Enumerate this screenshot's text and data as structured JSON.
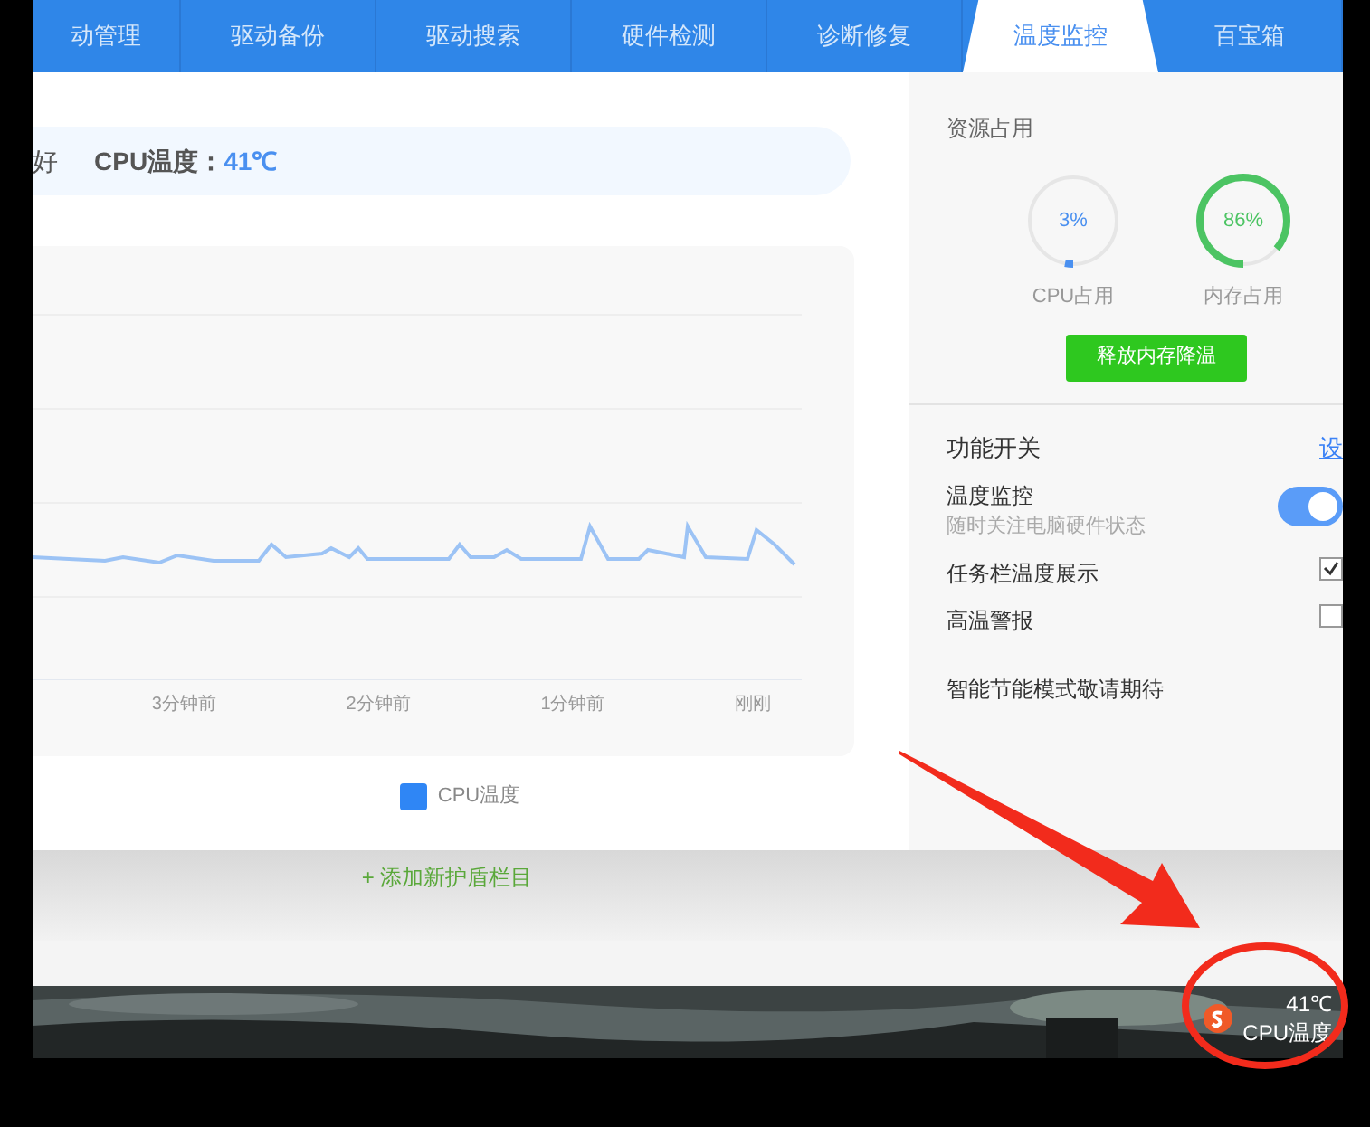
{
  "tabs": [
    {
      "label": "动管理",
      "selected": false
    },
    {
      "label": "驱动备份",
      "selected": false
    },
    {
      "label": "驱动搜索",
      "selected": false
    },
    {
      "label": "硬件检测",
      "selected": false
    },
    {
      "label": "诊断修复",
      "selected": false
    },
    {
      "label": "温度监控",
      "selected": true
    },
    {
      "label": "百宝箱",
      "selected": false
    }
  ],
  "status": {
    "state": "好",
    "label": "CPU温度：",
    "value": "41℃"
  },
  "chart": {
    "x_labels": [
      "3分钟前",
      "2分钟前",
      "1分钟前",
      "刚刚"
    ],
    "legend": "CPU温度"
  },
  "add_link": "+ 添加新护盾栏目",
  "resources": {
    "title": "资源占用",
    "meters": [
      {
        "name": "CPU占用",
        "reading": "3%",
        "level": 0.03,
        "color": "#4a90f0"
      },
      {
        "name": "内存占用",
        "reading": "86%",
        "level": 0.86,
        "color": "#4cc463"
      }
    ],
    "button": "释放内存降温"
  },
  "switches": {
    "title": "功能开关",
    "link": "设",
    "items": [
      {
        "kind": "toggle",
        "label": "温度监控",
        "hint": "随时关注电脑硬件状态",
        "on": true
      },
      {
        "kind": "checkbox",
        "label": "任务栏温度展示",
        "checked": true
      },
      {
        "kind": "checkbox",
        "label": "高温警报",
        "checked": false
      }
    ],
    "note": "智能节能模式敬请期待"
  },
  "tray": {
    "temperature": "41℃",
    "label": "CPU温度"
  }
}
